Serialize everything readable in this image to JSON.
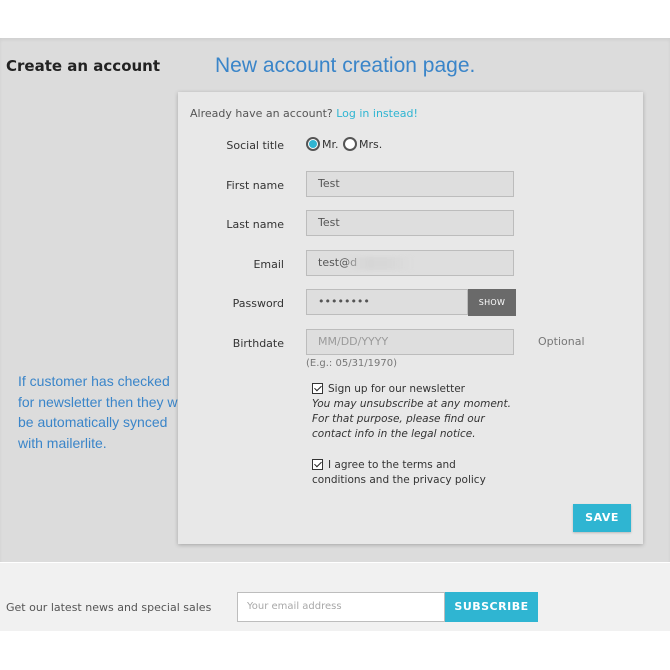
{
  "page": {
    "title": "Create an account",
    "annotation_title": "New account creation page.",
    "annotation_note": "If customer has checked for newsletter then they will be automatically synced with mailerlite."
  },
  "form": {
    "already_text": "Already have an account?",
    "login_link": "Log in instead!",
    "social_title": {
      "label": "Social title",
      "options": [
        "Mr.",
        "Mrs."
      ],
      "selected": "Mr."
    },
    "first_name": {
      "label": "First name",
      "value": "Test"
    },
    "last_name": {
      "label": "Last name",
      "value": "Test"
    },
    "email": {
      "label": "Email",
      "value": "test@d"
    },
    "password": {
      "label": "Password",
      "value": "••••••••",
      "show_label": "SHOW"
    },
    "birthdate": {
      "label": "Birthdate",
      "placeholder": "MM/DD/YYYY",
      "optional": "Optional",
      "hint": "(E.g.: 05/31/1970)"
    },
    "newsletter": {
      "checked": true,
      "label": "Sign up for our newsletter",
      "sub_text": "You may unsubscribe at any moment. For that purpose, please find our contact info in the legal notice."
    },
    "terms": {
      "checked": true,
      "label": "I agree to the terms and conditions and the privacy policy"
    },
    "save_label": "SAVE"
  },
  "footer": {
    "text": "Get our latest news and special sales",
    "email_placeholder": "Your email address",
    "subscribe_label": "SUBSCRIBE"
  },
  "colors": {
    "accent": "#2fb5d2",
    "annotation": "#3a85c9"
  }
}
